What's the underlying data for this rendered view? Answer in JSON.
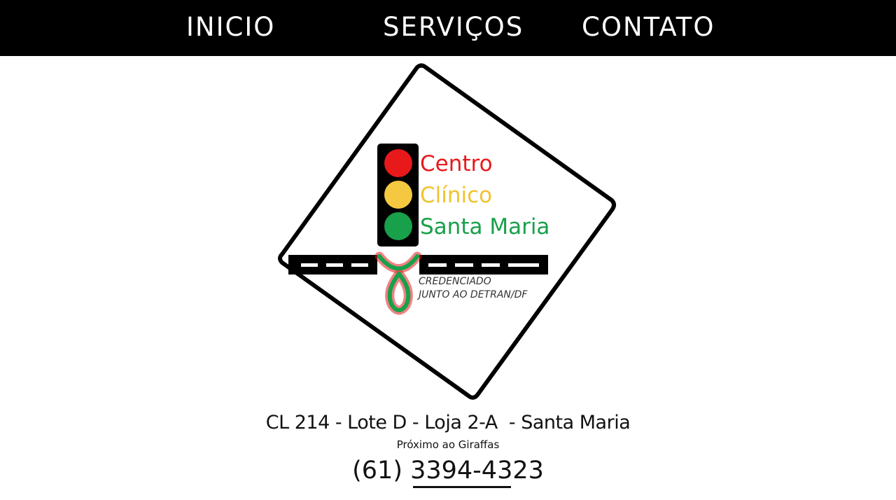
{
  "nav": {
    "items": [
      {
        "label": "INICIO"
      },
      {
        "label": "SERVIÇOS"
      },
      {
        "label": "CONTATO"
      }
    ]
  },
  "logo": {
    "line1": "Centro",
    "line2": "Clínico",
    "line3": "Santa Maria",
    "badge_line1": "CREDENCIADO",
    "badge_line2": "JUNTO AO DETRAN/DF",
    "colors": {
      "red": "#e8191b",
      "yellow": "#f5c842",
      "green": "#18a04a",
      "text_red": "#e8191b",
      "text_yellow": "#f2c230",
      "text_green": "#18a04a"
    },
    "icons": [
      "traffic-light-icon",
      "road-icon",
      "ribbon-icon"
    ]
  },
  "contact": {
    "address": "CL 214 - Lote D - Loja 2-A  - Santa Maria",
    "reference": "Próximo ao Giraffas",
    "phone": "(61) 3394-4323"
  }
}
